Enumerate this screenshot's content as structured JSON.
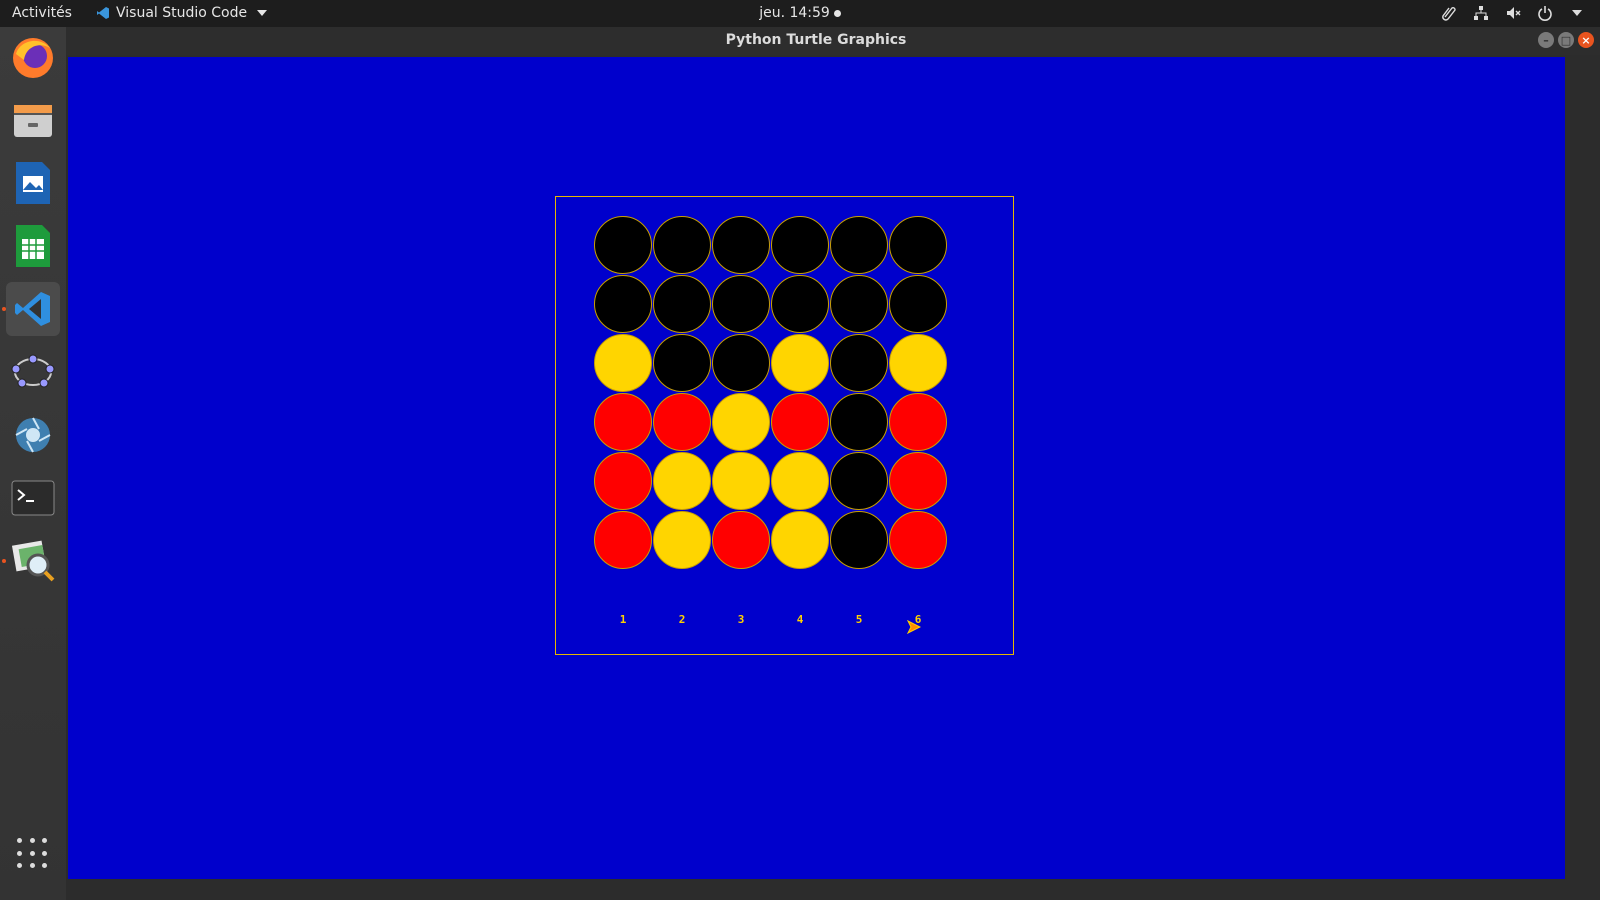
{
  "topbar": {
    "activities": "Activités",
    "app_name": "Visual Studio Code",
    "clock": "jeu. 14:59"
  },
  "window": {
    "title": "Python Turtle Graphics"
  },
  "game": {
    "background": "#0000cc",
    "border_color": "#e6b800",
    "colors": {
      "black": "#000000",
      "yellow": "#ffd500",
      "red": "#ff0000"
    },
    "board": [
      [
        "black",
        "black",
        "black",
        "black",
        "black",
        "black"
      ],
      [
        "black",
        "black",
        "black",
        "black",
        "black",
        "black"
      ],
      [
        "yellow",
        "black",
        "black",
        "yellow",
        "black",
        "yellow"
      ],
      [
        "red",
        "red",
        "yellow",
        "red",
        "black",
        "red"
      ],
      [
        "red",
        "yellow",
        "yellow",
        "yellow",
        "black",
        "red"
      ],
      [
        "red",
        "yellow",
        "red",
        "yellow",
        "black",
        "red"
      ]
    ],
    "column_labels": [
      "1",
      "2",
      "3",
      "4",
      "5",
      "6"
    ]
  }
}
